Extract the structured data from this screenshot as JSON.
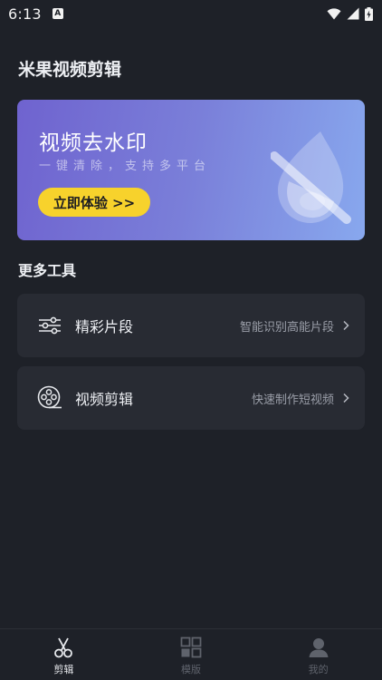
{
  "status_bar": {
    "time": "6:13",
    "notification_icon": "a-letter-icon",
    "icons": [
      "wifi-icon",
      "signal-icon",
      "battery-charging-icon"
    ]
  },
  "app": {
    "title": "米果视频剪辑"
  },
  "banner": {
    "title": "视频去水印",
    "subtitle": "一键清除，支持多平台",
    "button_label": "立即体验 >>",
    "illustration": "water-drop-erase-icon",
    "gradient_start": "#6f63cf",
    "gradient_end": "#88a8ee",
    "button_color": "#f7d22c"
  },
  "tools_section": {
    "title": "更多工具",
    "items": [
      {
        "name": "精彩片段",
        "description": "智能识别高能片段",
        "icon": "sliders-icon"
      },
      {
        "name": "视频剪辑",
        "description": "快速制作短视频",
        "icon": "film-reel-icon"
      }
    ]
  },
  "bottom_nav": {
    "items": [
      {
        "label": "剪辑",
        "icon": "scissors-icon",
        "active": true
      },
      {
        "label": "模版",
        "icon": "template-grid-icon",
        "active": false
      },
      {
        "label": "我的",
        "icon": "user-icon",
        "active": false
      }
    ]
  }
}
